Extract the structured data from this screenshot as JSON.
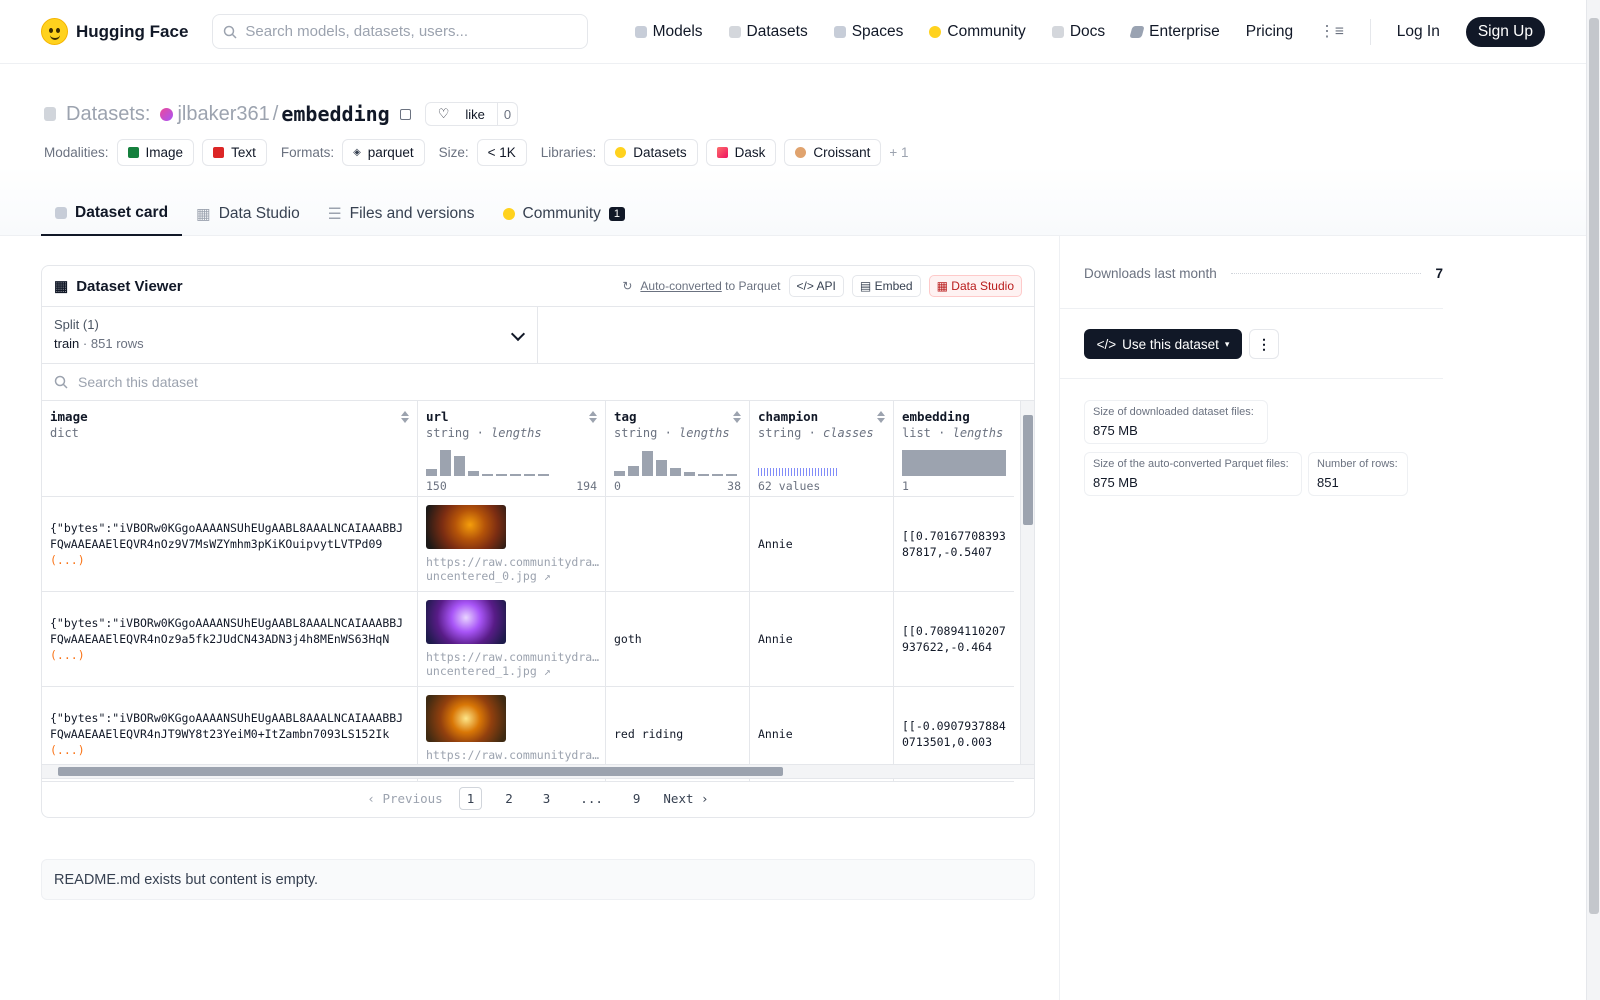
{
  "nav": {
    "brand": "Hugging Face",
    "search_placeholder": "Search models, datasets, users...",
    "links": [
      "Models",
      "Datasets",
      "Spaces",
      "Community",
      "Docs",
      "Enterprise",
      "Pricing"
    ],
    "login": "Log In",
    "signup": "Sign Up"
  },
  "header": {
    "section": "Datasets:",
    "owner": "jlbaker361",
    "slash": "/",
    "repo": "embedding",
    "like_label": "like",
    "like_count": "0",
    "modalities_label": "Modalities:",
    "modalities": [
      "Image",
      "Text"
    ],
    "formats_label": "Formats:",
    "format": "parquet",
    "size_label": "Size:",
    "size": "< 1K",
    "libraries_label": "Libraries:",
    "libraries": [
      "Datasets",
      "Dask",
      "Croissant"
    ],
    "more_libraries": "+ 1"
  },
  "tabs": [
    {
      "label": "Dataset card"
    },
    {
      "label": "Data Studio"
    },
    {
      "label": "Files and versions"
    },
    {
      "label": "Community",
      "badge": "1"
    }
  ],
  "viewer": {
    "title": "Dataset Viewer",
    "auto_converted": "Auto-converted",
    "to_parquet": "to Parquet",
    "api": "API",
    "embed": "Embed",
    "data_studio": "Data Studio",
    "split_label": "Split (1)",
    "split_name": "train",
    "split_rows": "851 rows",
    "search_placeholder": "Search this dataset",
    "columns": [
      {
        "name": "image",
        "type": "dict",
        "stat": ""
      },
      {
        "name": "url",
        "type": "string",
        "stat": "lengths",
        "min": "150",
        "max": "194"
      },
      {
        "name": "tag",
        "type": "string",
        "stat": "lengths",
        "min": "0",
        "max": "38"
      },
      {
        "name": "champion",
        "type": "string",
        "stat": "classes",
        "summary": "62 values"
      },
      {
        "name": "embedding",
        "type": "list",
        "stat": "lengths",
        "min": "1"
      }
    ],
    "rows": [
      {
        "image": "{\"bytes\":\"iVBORw0KGgoAAAANSUhEUgAABL8AAALNCAIAAABBJFQwAAEAAElEQVR4nOz9V7MsWZYmhm3pKiKOuipvytLVTPd09",
        "url1": "https://raw.communitydra…",
        "url2": "uncentered_0.jpg ↗",
        "tag": "",
        "champion": "Annie",
        "embedding": "[[0.7016770839387817,-0.5407"
      },
      {
        "image": "{\"bytes\":\"iVBORw0KGgoAAAANSUhEUgAABL8AAALNCAIAAABBJFQwAAEAAElEQVR4nOz9a5fk2JUdCN43ADN3j4h8MEnWS63HqN",
        "url1": "https://raw.communitydra…",
        "url2": "uncentered_1.jpg ↗",
        "tag": "goth",
        "champion": "Annie",
        "embedding": "[[0.70894110207937622,-0.464"
      },
      {
        "image": "{\"bytes\":\"iVBORw0KGgoAAAANSUhEUgAABL8AAALNCAIAAABBJFQwAAEAAElEQVR4nJT9WY8t23YeiM0+ItZambn7093LS152Ik",
        "url1": "https://raw.communitydra…",
        "url2": "",
        "tag": "red riding",
        "champion": "Annie",
        "embedding": "[[-0.09079378840713501,0.003"
      }
    ],
    "ellipsis": "(...)",
    "pager": {
      "prev": "Previous",
      "pages": [
        "1",
        "2",
        "3",
        "...",
        "9"
      ],
      "next": "Next",
      "current": "1"
    }
  },
  "readme": "README.md exists but content is empty.",
  "sidebar": {
    "downloads_label": "Downloads last month",
    "downloads_value": "7",
    "use_button": "Use this dataset",
    "stats": [
      {
        "label": "Size of downloaded dataset files:",
        "value": "875 MB"
      },
      {
        "label": "Size of the auto-converted Parquet files:",
        "value": "875 MB"
      },
      {
        "label": "Number of rows:",
        "value": "851"
      }
    ]
  },
  "colors": {
    "brand_yellow": "#FFD21E",
    "dark": "#111827",
    "red_accent": "#b91c1c"
  }
}
